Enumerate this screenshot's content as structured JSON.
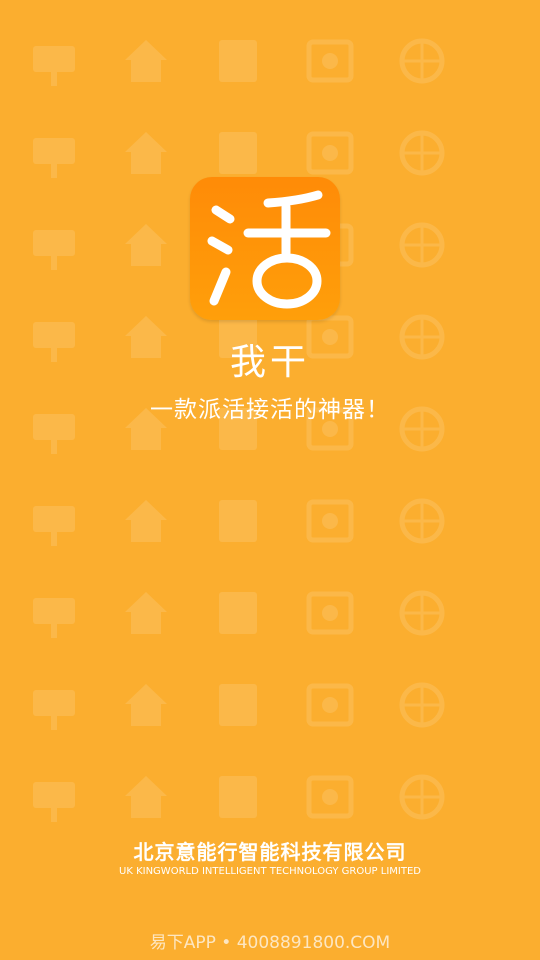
{
  "splash": {
    "app_name": "我干",
    "logo_char": "活",
    "slogan": "一款派活接活的神器！"
  },
  "footer": {
    "company_cn": "北京意能行智能科技有限公司",
    "company_en": "UK KINGWORLD INTELLIGENT TECHNOLOGY GROUP LIMITED"
  },
  "watermark": {
    "text": "易下APP • 4008891800.COM"
  },
  "colors": {
    "background": "#fbae2f",
    "logo_bg": "#ff9208",
    "text": "#ffffff"
  },
  "background_icons": [
    "signboard-icon",
    "photo-frame-icon",
    "photo-frame-icon",
    "flag-icon",
    "flag-icon",
    "checkered-flag-icon",
    "finish-line-icon",
    "podium-icon",
    "trophy-icon",
    "house-icon",
    "building-icon",
    "link-icon",
    "document-icon",
    "document-icon",
    "document-icon",
    "book-icon",
    "bank-icon",
    "clock-icon",
    "tree-icon",
    "barrier-icon",
    "umbrella-icon",
    "envelope-icon",
    "envelope-icon",
    "lifebuoy-icon",
    "rss-icon",
    "network-icon",
    "map-icon",
    "skyscraper-icon",
    "factory-icon",
    "clapperboard-icon",
    "pacman-icon",
    "safe-icon",
    "car-icon",
    "card-icon",
    "bandage-icon",
    "id-card-icon",
    "warning-icon",
    "alert-icon",
    "bell-icon",
    "bell-icon",
    "robot-icon",
    "globe-icon",
    "globe-stand-icon",
    "lab-flask-icon",
    "lightbulb-icon"
  ]
}
